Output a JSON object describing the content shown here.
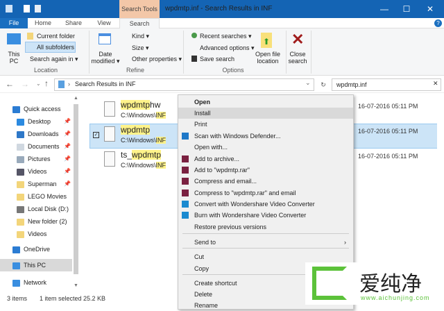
{
  "window": {
    "context_tab": "Search Tools",
    "title": "wpdmtp.inf - Search Results in INF",
    "minimize": "—",
    "maximize": "☐",
    "close": "✕"
  },
  "tabs": [
    "File",
    "Home",
    "Share",
    "View",
    "Search"
  ],
  "ribbon": {
    "location": {
      "this_pc": "This PC",
      "current_folder": "Current folder",
      "all_subfolders": "All subfolders",
      "search_again": "Search again in ▾",
      "label": "Location"
    },
    "refine": {
      "date_modified": "Date modified ▾",
      "kind": "Kind ▾",
      "size": "Size ▾",
      "other": "Other properties ▾",
      "label": "Refine"
    },
    "options": {
      "recent": "Recent searches ▾",
      "advanced": "Advanced options ▾",
      "save": "Save search",
      "open_location": "Open file location",
      "label": "Options"
    },
    "close_search": "Close search"
  },
  "address": {
    "path": "Search Results in INF",
    "search": "wpdmtp.inf"
  },
  "nav": [
    {
      "label": "Quick access",
      "color": "#2b7cd3"
    },
    {
      "label": "Desktop",
      "color": "#2b8ae0",
      "pin": true
    },
    {
      "label": "Downloads",
      "color": "#2e78c8",
      "pin": true
    },
    {
      "label": "Documents",
      "color": "#d0d8e0",
      "pin": true
    },
    {
      "label": "Pictures",
      "color": "#9ab",
      "pin": true
    },
    {
      "label": "Videos",
      "color": "#556",
      "pin": true
    },
    {
      "label": "Superman",
      "color": "#f3d57a",
      "pin": true
    },
    {
      "label": "LEGO Movies",
      "color": "#f3d57a"
    },
    {
      "label": "Local Disk (D:)",
      "color": "#777"
    },
    {
      "label": "New folder (2)",
      "color": "#f3d57a"
    },
    {
      "label": "Videos",
      "color": "#f3d57a"
    },
    {
      "label": "OneDrive",
      "color": "#2b7cd3"
    },
    {
      "label": "This PC",
      "color": "#3a8ee0"
    },
    {
      "label": "Network",
      "color": "#3a8ee0"
    }
  ],
  "files": [
    {
      "pre": "",
      "hl": "wpdmtp",
      "post": "hw",
      "path_pre": "C:\\Windows\\",
      "path_hl": "INF",
      "date": "16-07-2016 05:11 PM"
    },
    {
      "pre": "",
      "hl": "wpdmtp",
      "post": "",
      "path_pre": "C:\\Windows\\",
      "path_hl": "INF",
      "date": "16-07-2016 05:11 PM"
    },
    {
      "pre": "ts_",
      "hl": "wpdmtp",
      "post": "",
      "path_pre": "C:\\Windows\\",
      "path_hl": "INF",
      "date": "16-07-2016 05:11 PM"
    }
  ],
  "menu": [
    "Open",
    "Install",
    "Print",
    "Scan with Windows Defender...",
    "Open with...",
    "Add to archive...",
    "Add to \"wpdmtp.rar\"",
    "Compress and email...",
    "Compress to \"wpdmtp.rar\" and email",
    "Convert with Wondershare Video Converter",
    "Burn with Wondershare Video Converter",
    "Restore previous versions",
    "Send to",
    "Cut",
    "Copy",
    "Create shortcut",
    "Delete",
    "Rename"
  ],
  "status": {
    "count": "3 items",
    "selected": "1 item selected  25.2 KB"
  },
  "watermark": {
    "brand": "爱纯净",
    "url": "www.aichunjing.com"
  }
}
